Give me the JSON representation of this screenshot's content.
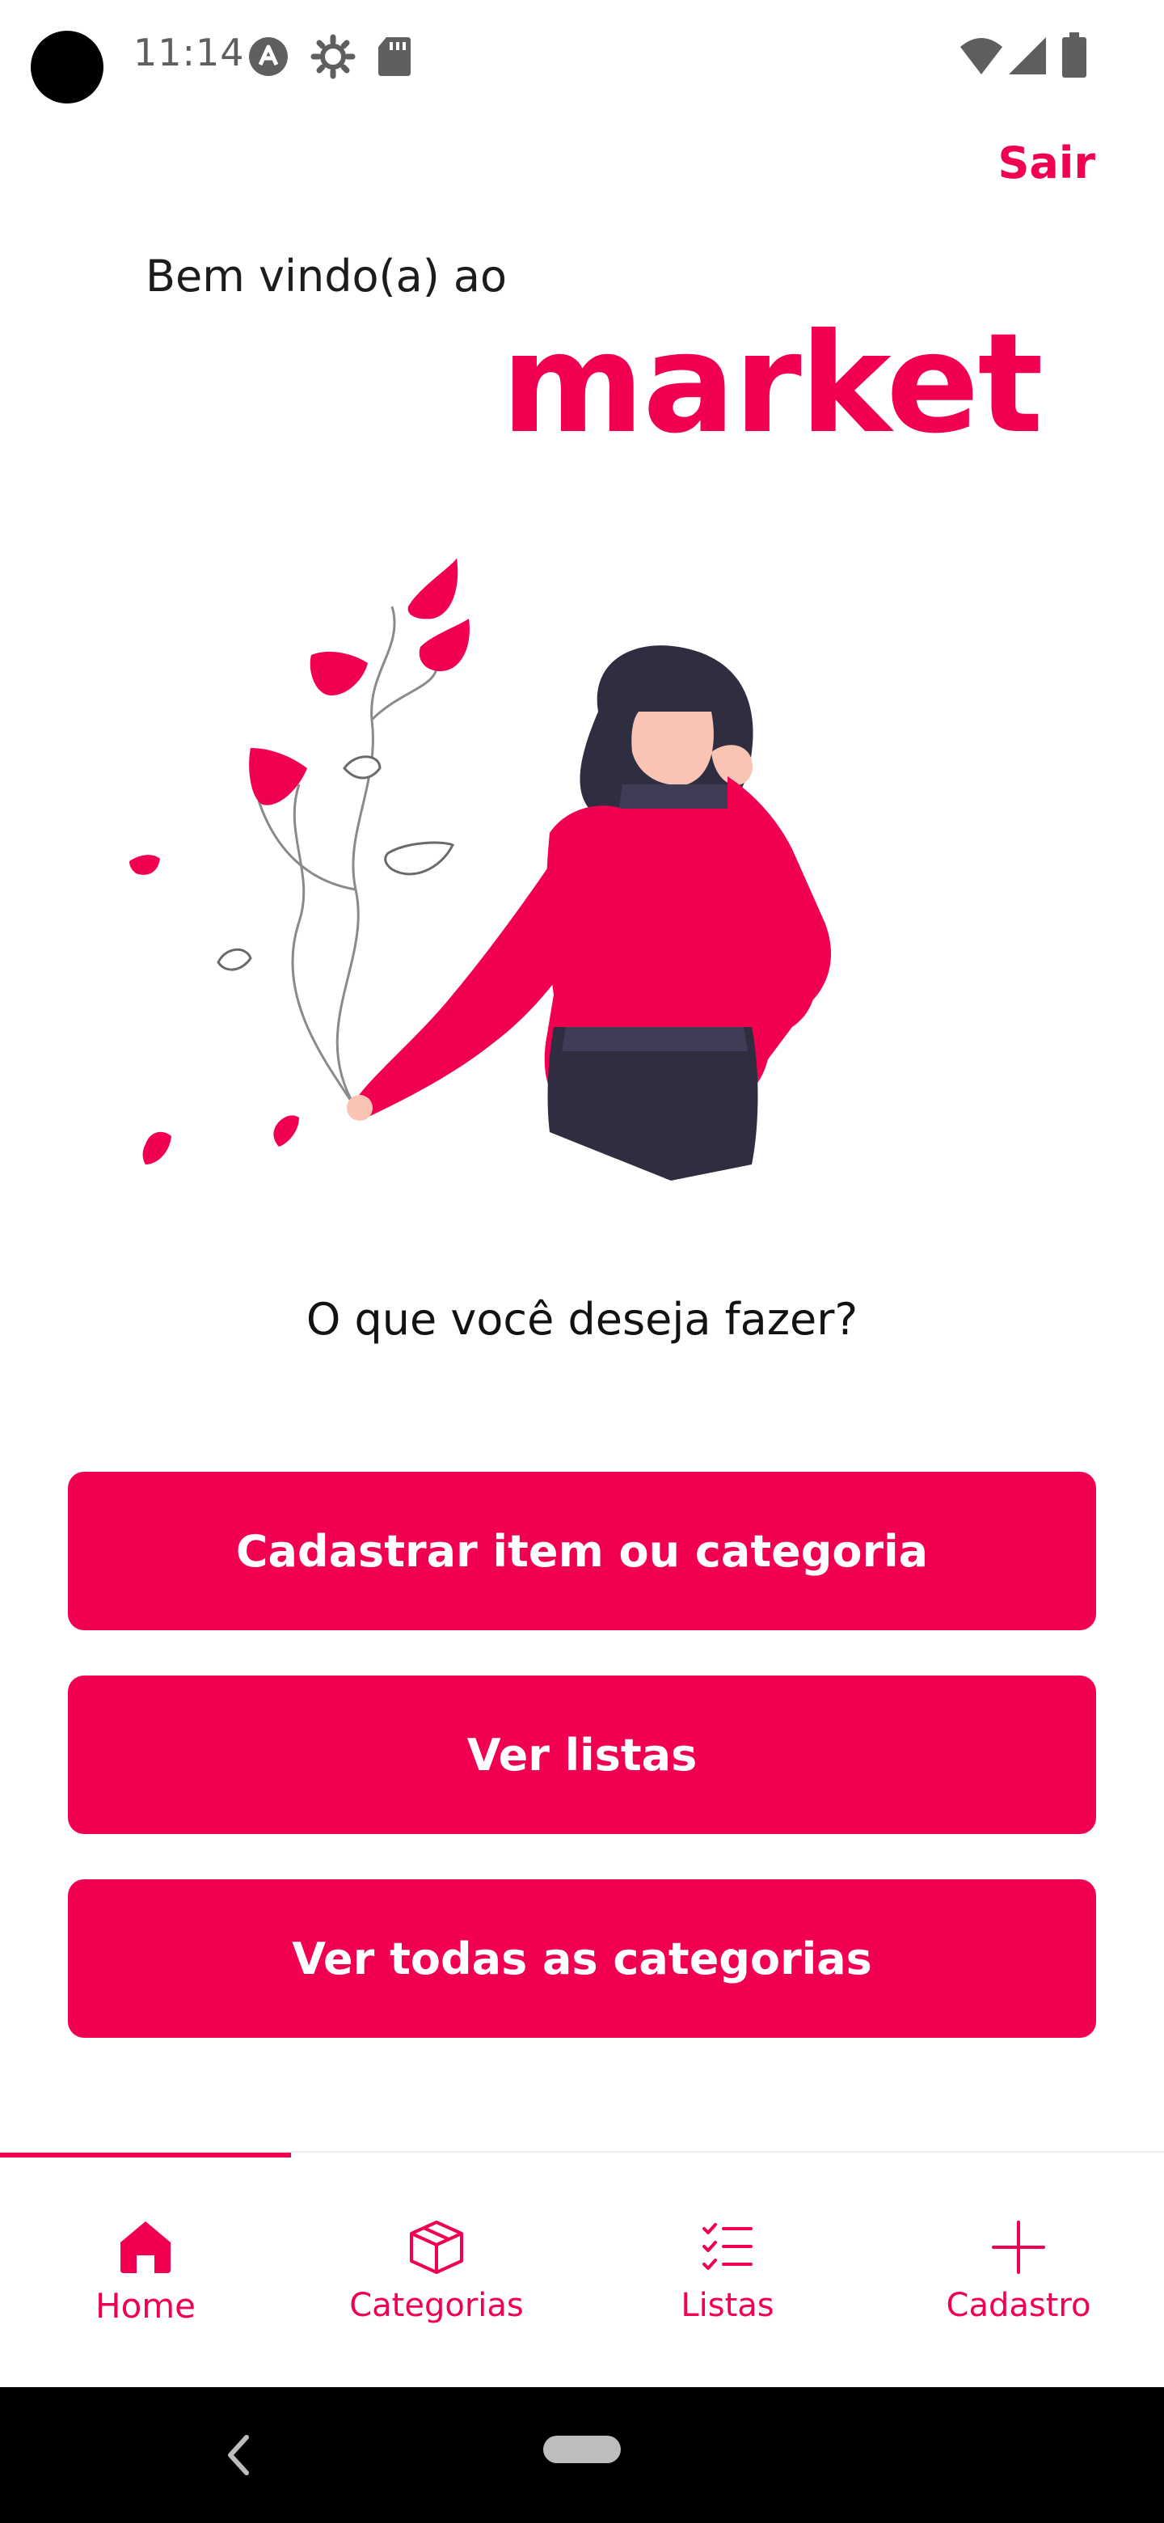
{
  "status_bar": {
    "time": "11:14"
  },
  "header": {
    "logout_label": "Sair",
    "welcome": "Bem vindo(a) ao",
    "brand": "market"
  },
  "main": {
    "question": "O que você deseja fazer?",
    "actions": [
      {
        "label": "Cadastrar item ou categoria"
      },
      {
        "label": "Ver listas"
      },
      {
        "label": "Ver todas as categorias"
      }
    ]
  },
  "tabs": [
    {
      "label": "Home",
      "icon": "home-icon",
      "active": true
    },
    {
      "label": "Categorias",
      "icon": "box-icon",
      "active": false
    },
    {
      "label": "Listas",
      "icon": "checklist-icon",
      "active": false
    },
    {
      "label": "Cadastro",
      "icon": "plus-icon",
      "active": false
    }
  ],
  "colors": {
    "accent": "#f10052",
    "text": "#1c1c1c",
    "dark": "#2f2e41"
  }
}
